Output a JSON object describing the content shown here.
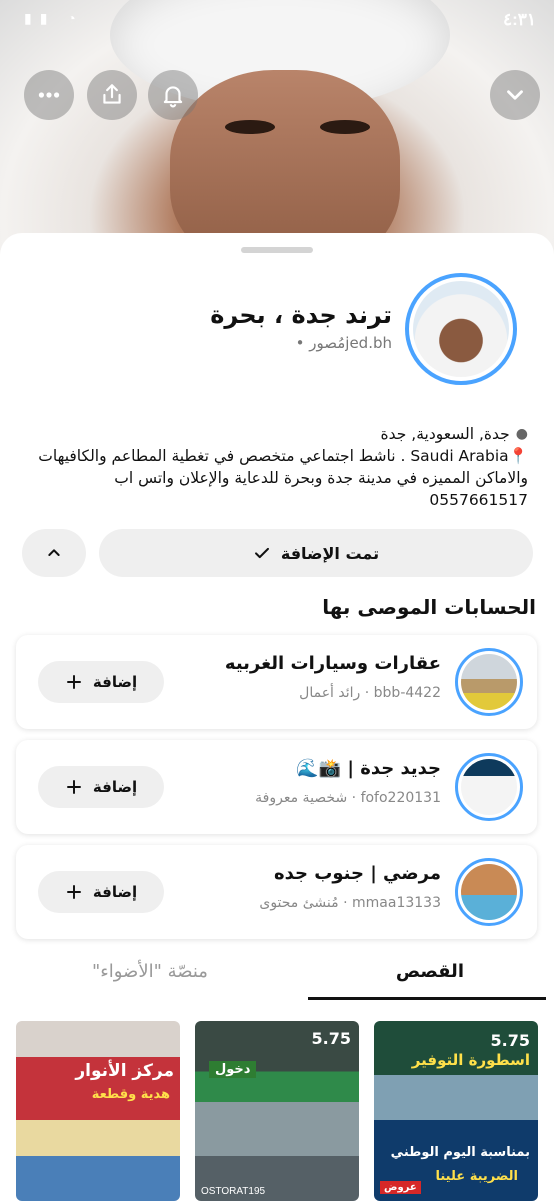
{
  "status_bar": {
    "time": "٤:٣١"
  },
  "profile": {
    "name": "ترند جدة ، بحرة",
    "handle": "jed.bh",
    "category": "مُصور",
    "location": "جدة, السعودية, جدة",
    "bio_line1": "📍Saudi Arabia . ناشط اجتماعي متخصص في تغطية المطاعم والكافيهات",
    "bio_line2": "والاماكن المميزه في مدينة جدة وبحرة للدعاية والإعلان واتس اب",
    "bio_line3": "0557661517"
  },
  "actions": {
    "added_label": "تمت الإضافة"
  },
  "recommended": {
    "title": "الحسابات الموصى بها",
    "add_label": "إضافة",
    "items": [
      {
        "name": "عقارات وسيارات الغربيه",
        "handle": "bbb-4422",
        "role": "رائد أعمال"
      },
      {
        "name": "جديد جدة | 📸🌊",
        "handle": "fofo220131",
        "role": "شخصية معروفة"
      },
      {
        "name": "مرضي | جنوب جده",
        "handle": "mmaa13133",
        "role": "مُنشئ محتوى"
      }
    ]
  },
  "tabs": {
    "stories": "القصص",
    "spotlight": "منصّة \"الأضواء\""
  },
  "stories": [
    {
      "headline": "5.75",
      "line1": "اسطورة التوفير",
      "line2": "بمناسبة اليوم الوطني",
      "line3": "الضريبة علينا",
      "badge": "عروض"
    },
    {
      "headline": "5.75",
      "line1": "دخول",
      "caption": "OSTORAT195"
    },
    {
      "headline": "مركز الأنوار",
      "line1": "هدية وقطعة"
    }
  ],
  "colors": {
    "accent_ring": "#4aa3ff",
    "button_bg": "#efefef"
  }
}
